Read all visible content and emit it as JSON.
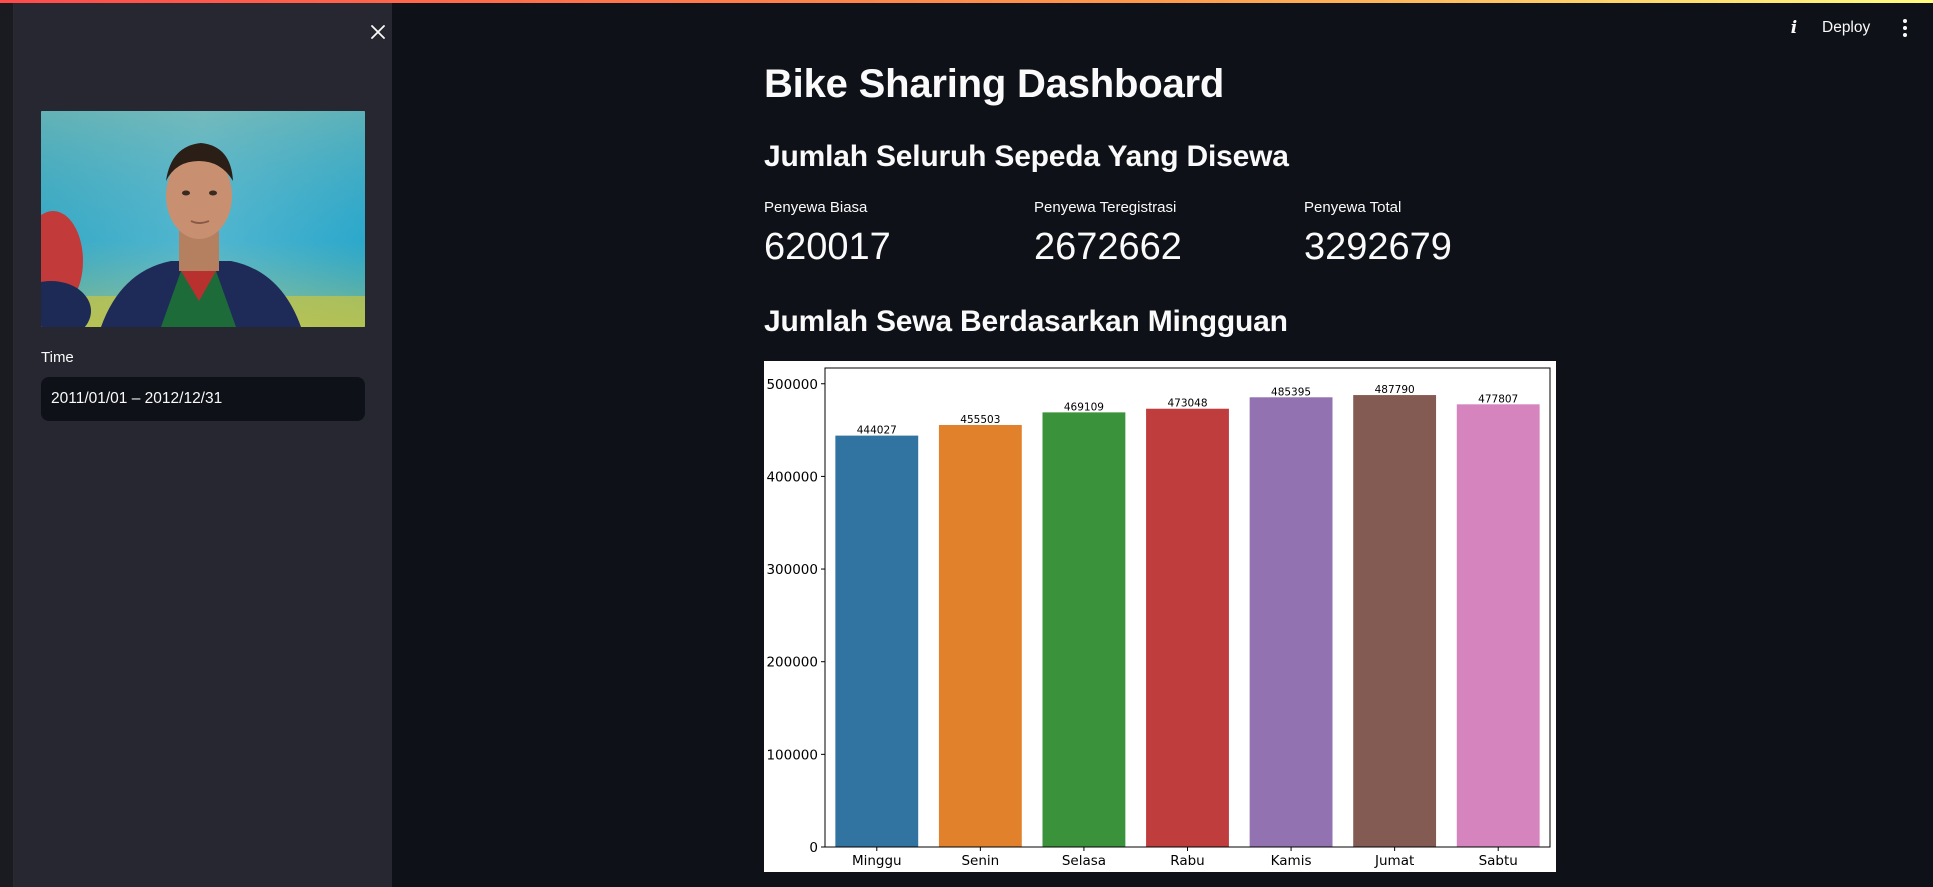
{
  "sidebar": {
    "close_icon": "close-icon",
    "time_label": "Time",
    "date_range_value": "2011/01/01 – 2012/12/31"
  },
  "topbar": {
    "info_icon": "info-icon",
    "deploy_label": "Deploy",
    "menu_icon": "kebab-menu-icon"
  },
  "main": {
    "title": "Bike Sharing Dashboard",
    "subheader_total": "Jumlah Seluruh Sepeda Yang Disewa",
    "metrics": [
      {
        "label": "Penyewa Biasa",
        "value": "620017"
      },
      {
        "label": "Penyewa Teregistrasi",
        "value": "2672662"
      },
      {
        "label": "Penyewa Total",
        "value": "3292679"
      }
    ],
    "subheader_weekly": "Jumlah Sewa Berdasarkan Mingguan"
  },
  "chart_data": {
    "type": "bar",
    "categories": [
      "Minggu",
      "Senin",
      "Selasa",
      "Rabu",
      "Kamis",
      "Jumat",
      "Sabtu"
    ],
    "values": [
      444027,
      455503,
      469109,
      473048,
      485395,
      487790,
      477807
    ],
    "data_labels": [
      "444027",
      "455503",
      "469109",
      "473048",
      "485395",
      "487790",
      "477807"
    ],
    "colors": [
      "#3274a1",
      "#e1812c",
      "#3a923a",
      "#c03d3e",
      "#9372b2",
      "#845b53",
      "#d684bd"
    ],
    "ylim": [
      0,
      517000
    ],
    "yticks": [
      0,
      100000,
      200000,
      300000,
      400000,
      500000
    ],
    "ytick_labels": [
      "0",
      "100000",
      "200000",
      "300000",
      "400000",
      "500000"
    ],
    "title": "",
    "xlabel": "",
    "ylabel": "",
    "grid": false
  }
}
